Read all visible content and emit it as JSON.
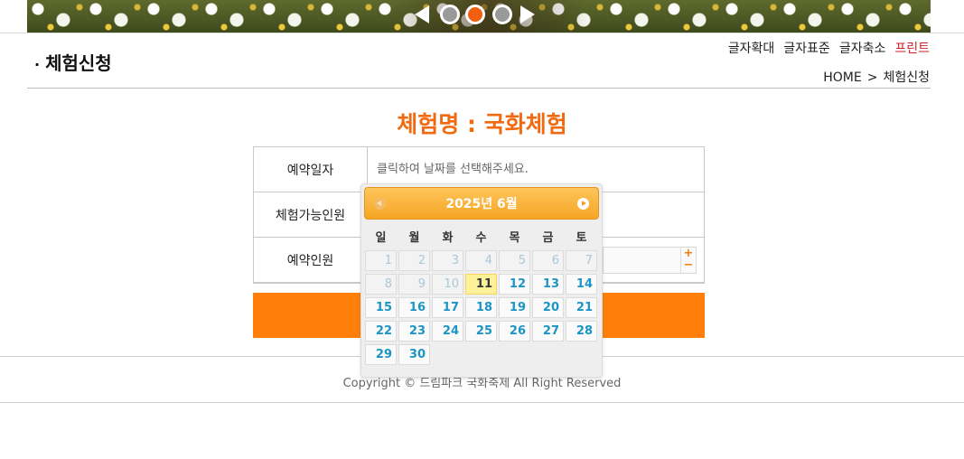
{
  "banner": {
    "slides": [
      {
        "active": false
      },
      {
        "active": true
      },
      {
        "active": false
      }
    ]
  },
  "header": {
    "title": "체험신청",
    "bullet": "·",
    "tools": {
      "zoom_in": "글자확대",
      "normal": "글자표준",
      "zoom_out": "글자축소",
      "print": "프린트"
    },
    "breadcrumb": {
      "home": "HOME",
      "separator": ">",
      "current": "체험신청"
    }
  },
  "main": {
    "heading": "체험명 : 국화체험",
    "form": {
      "date_label": "예약일자",
      "date_placeholder": "클릭하여 날짜를 선택해주세요.",
      "capacity_label": "체험가능인원",
      "people_label": "예약인원",
      "stepper_plus": "+",
      "stepper_minus": "−"
    }
  },
  "datepicker": {
    "title": "2025년 6월",
    "weekdays": [
      "일",
      "월",
      "화",
      "수",
      "목",
      "금",
      "토"
    ],
    "days": [
      {
        "d": "1",
        "state": "disabled"
      },
      {
        "d": "2",
        "state": "disabled"
      },
      {
        "d": "3",
        "state": "disabled"
      },
      {
        "d": "4",
        "state": "disabled"
      },
      {
        "d": "5",
        "state": "disabled"
      },
      {
        "d": "6",
        "state": "disabled"
      },
      {
        "d": "7",
        "state": "disabled"
      },
      {
        "d": "8",
        "state": "disabled"
      },
      {
        "d": "9",
        "state": "disabled"
      },
      {
        "d": "10",
        "state": "disabled"
      },
      {
        "d": "11",
        "state": "today"
      },
      {
        "d": "12",
        "state": "enabled"
      },
      {
        "d": "13",
        "state": "enabled"
      },
      {
        "d": "14",
        "state": "enabled"
      },
      {
        "d": "15",
        "state": "enabled"
      },
      {
        "d": "16",
        "state": "enabled"
      },
      {
        "d": "17",
        "state": "enabled"
      },
      {
        "d": "18",
        "state": "enabled"
      },
      {
        "d": "19",
        "state": "enabled"
      },
      {
        "d": "20",
        "state": "enabled"
      },
      {
        "d": "21",
        "state": "enabled"
      },
      {
        "d": "22",
        "state": "enabled"
      },
      {
        "d": "23",
        "state": "enabled"
      },
      {
        "d": "24",
        "state": "enabled"
      },
      {
        "d": "25",
        "state": "enabled"
      },
      {
        "d": "26",
        "state": "enabled"
      },
      {
        "d": "27",
        "state": "enabled"
      },
      {
        "d": "28",
        "state": "enabled"
      },
      {
        "d": "29",
        "state": "enabled"
      },
      {
        "d": "30",
        "state": "enabled"
      }
    ],
    "colors": {
      "header": "#f7a524",
      "day_text": "#1c94c4",
      "today_bg": "#fdf29a"
    }
  },
  "footer": {
    "copyright": "Copyright © 드림파크 국화축제 All Right Reserved"
  },
  "colors": {
    "accent": "#f26a10",
    "submit": "#ff7f0a",
    "print": "#d0202a"
  }
}
